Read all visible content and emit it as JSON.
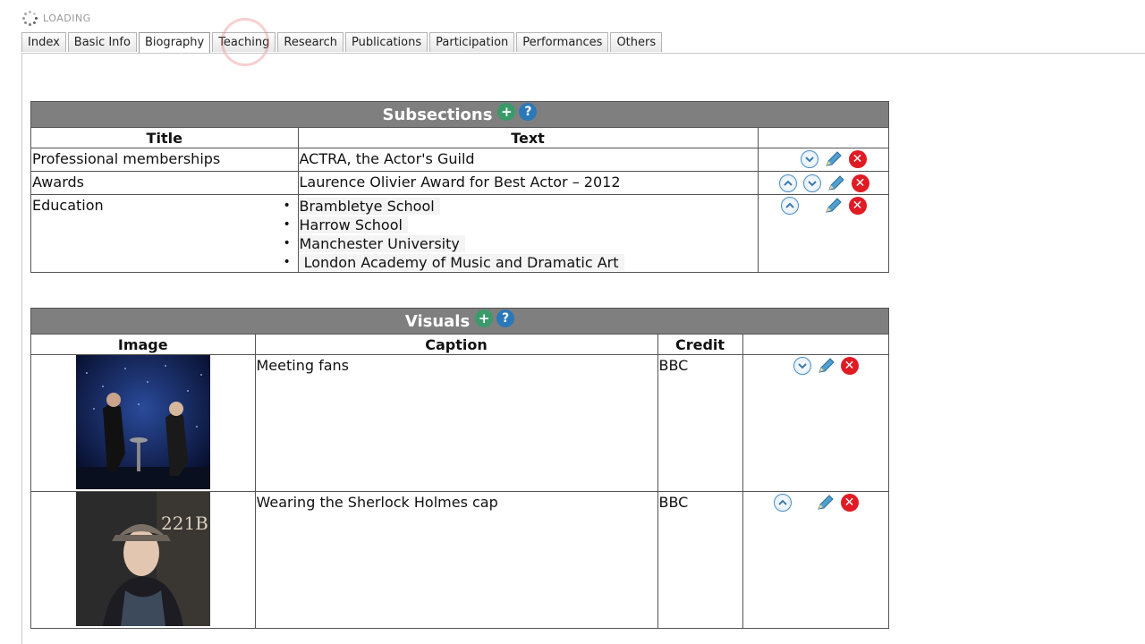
{
  "loading": {
    "label": "LOADING"
  },
  "tabs": [
    {
      "label": "Index"
    },
    {
      "label": "Basic Info"
    },
    {
      "label": "Biography"
    },
    {
      "label": "Teaching"
    },
    {
      "label": "Research"
    },
    {
      "label": "Publications"
    },
    {
      "label": "Participation"
    },
    {
      "label": "Performances"
    },
    {
      "label": "Others"
    }
  ],
  "active_tab": "Biography",
  "subsections": {
    "title": "Subsections",
    "columns": {
      "title": "Title",
      "text": "Text"
    },
    "rows": [
      {
        "title": "Professional memberships",
        "text": "ACTRA, the Actor's Guild"
      },
      {
        "title": "Awards",
        "text": "Laurence Olivier Award for Best Actor – 2012"
      },
      {
        "title": "Education",
        "items": [
          "Brambletye School",
          "Harrow School",
          "Manchester University",
          " London Academy of Music and Dramatic Art"
        ]
      }
    ]
  },
  "visuals": {
    "title": "Visuals",
    "columns": {
      "image": "Image",
      "caption": "Caption",
      "credit": "Credit"
    },
    "rows": [
      {
        "caption": "Meeting fans",
        "credit": "BBC"
      },
      {
        "caption": "Wearing the Sherlock Holmes cap",
        "credit": "BBC",
        "image_text": "221B"
      }
    ]
  },
  "colors": {
    "header_bg": "#7f7f7f",
    "plus_icon": "#3a9a6a",
    "help_icon": "#2b78b8",
    "delete_icon": "#e01b24",
    "move_icon": "#4a8ec4"
  }
}
